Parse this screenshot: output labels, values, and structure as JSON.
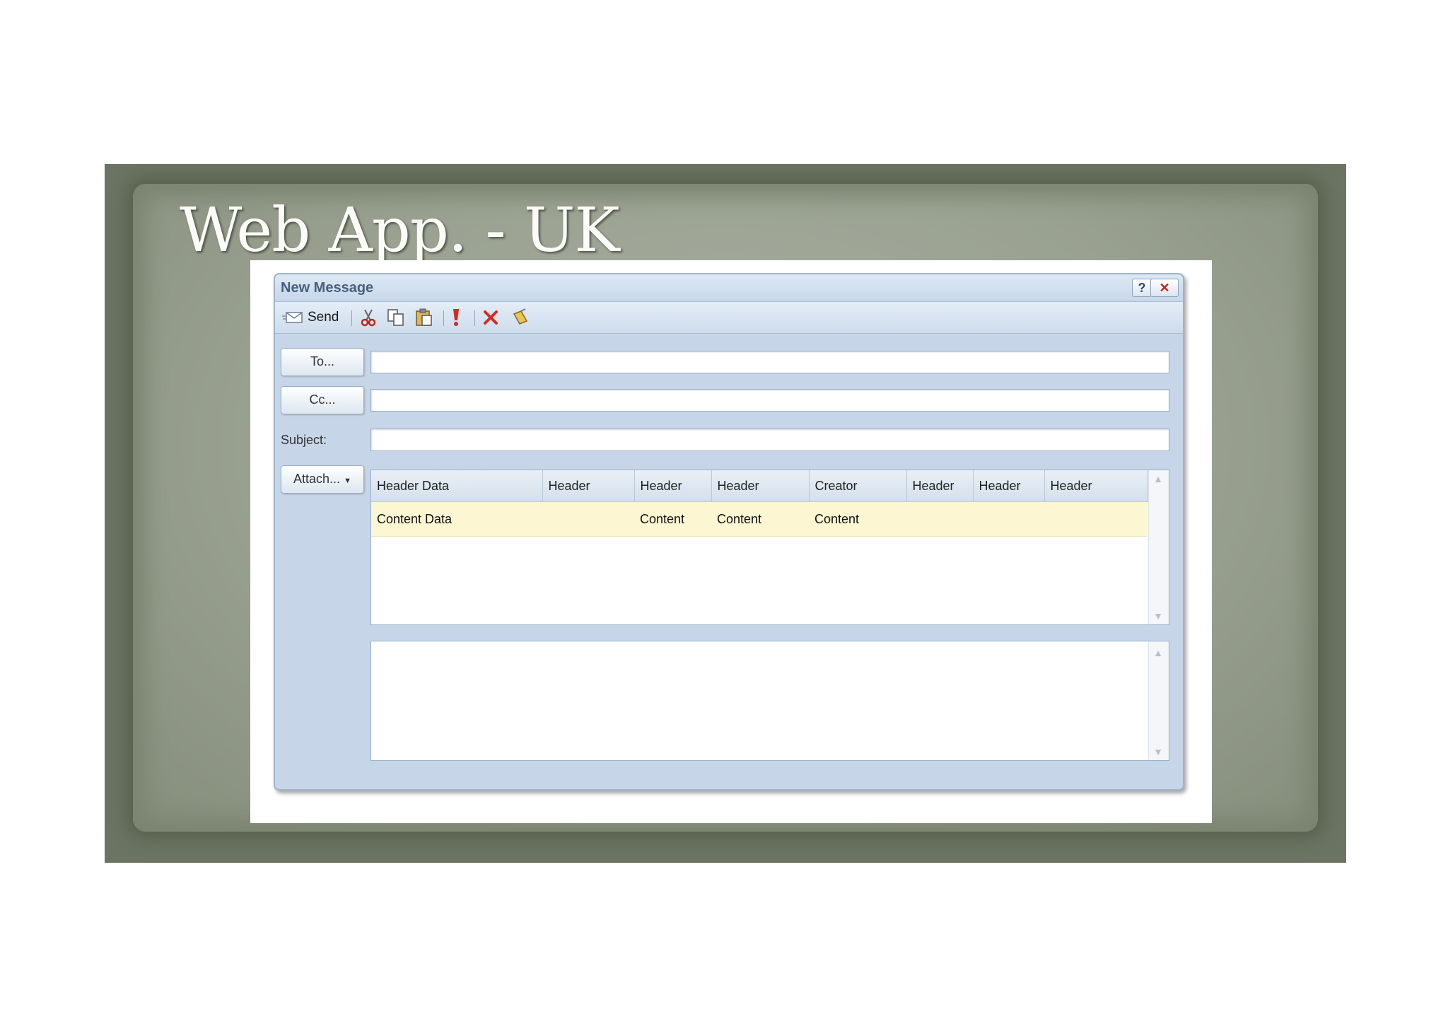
{
  "slide": {
    "title": "Web App. - UK"
  },
  "window": {
    "title": "New Message",
    "help_label": "?",
    "close_label": "✕"
  },
  "toolbar": {
    "send_label": "Send",
    "icons": [
      "send-icon",
      "cut-icon",
      "copy-icon",
      "paste-icon",
      "importance-icon",
      "delete-icon",
      "clear-icon"
    ]
  },
  "form": {
    "to_label": "To...",
    "cc_label": "Cc...",
    "subject_label": "Subject:",
    "attach_label": "Attach...",
    "to_value": "",
    "cc_value": "",
    "subject_value": ""
  },
  "attachments": {
    "columns": [
      "Header Data",
      "Header",
      "Header",
      "Header",
      "Creator",
      "Header",
      "Header",
      "Header"
    ],
    "rows": [
      [
        "Content Data",
        "",
        "Content",
        "Content",
        "Content",
        "",
        "",
        ""
      ]
    ]
  },
  "colors": {
    "window_bg": "#c6d6e8",
    "selected_row": "#fcf6d2",
    "close_red": "#c0251a",
    "slide_bg": "#6b7462"
  }
}
